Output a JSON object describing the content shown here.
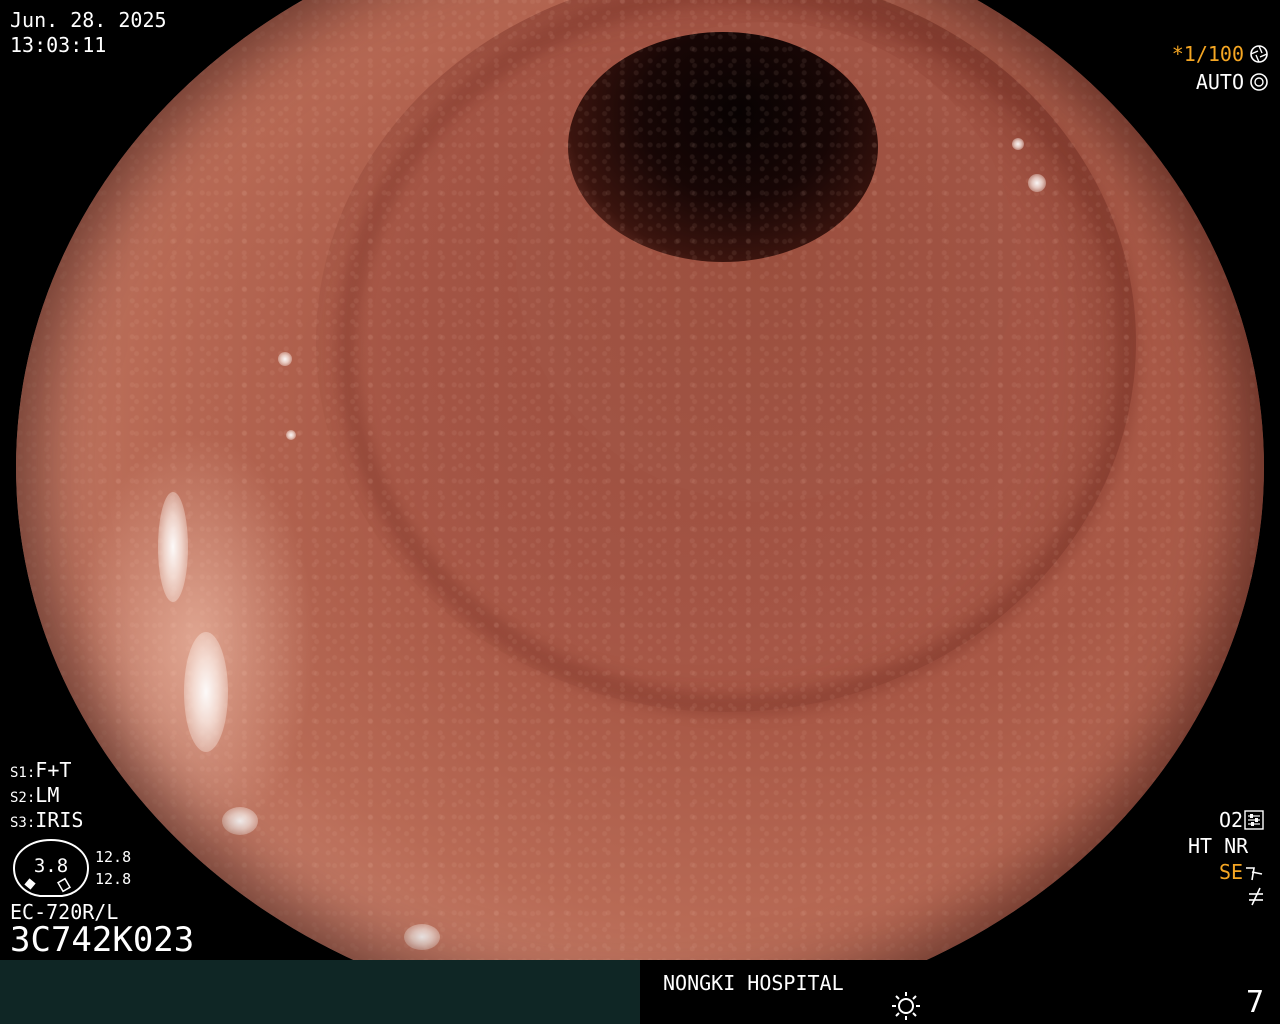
{
  "header": {
    "date": "Jun. 28. 2025",
    "time": "13:03:11"
  },
  "exposure": {
    "shutter": "*1/100",
    "shutter_icon": "shutter-icon",
    "mode": "AUTO",
    "mode_icon": "iris-icon"
  },
  "scope_switches": {
    "s1": {
      "prefix": "S1:",
      "label": "F+T"
    },
    "s2": {
      "prefix": "S2:",
      "label": "LM"
    },
    "s3": {
      "prefix": "S3:",
      "label": "IRIS"
    }
  },
  "bending": {
    "value": "3.8",
    "up_down": "12.8",
    "left_right": "12.8"
  },
  "scope": {
    "model": "EC-720R/L",
    "serial": "3C742K023"
  },
  "processing": {
    "o2": "O2",
    "ht_nr": "HT NR",
    "se": "SE"
  },
  "footer": {
    "hospital": "NONGKI HOSPITAL",
    "image_count": "7",
    "light_icon": "sun-icon"
  },
  "colors": {
    "accent_orange": "#f5a623",
    "footer_left_bg": "#0f2625",
    "text": "#ffffff"
  }
}
